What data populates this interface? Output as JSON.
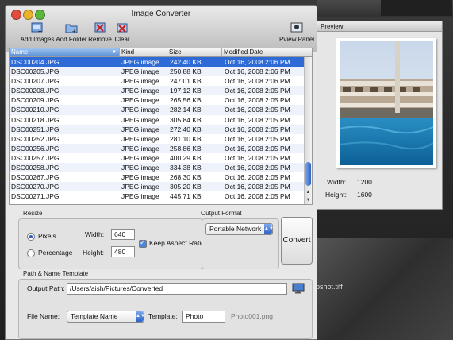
{
  "window": {
    "title": "Image Converter"
  },
  "toolbar": {
    "add_images": "Add Images",
    "add_folder": "Add Folder",
    "remove": "Remove",
    "clear": "Clear",
    "preview_panel": "Pview Panel"
  },
  "table": {
    "columns": [
      "Name",
      "Kind",
      "Size",
      "Modified Date"
    ],
    "rows": [
      {
        "name": "DSC00204.JPG",
        "kind": "JPEG image",
        "size": "242.40 KB",
        "date": "Oct 16, 2008 2:06 PM",
        "selected": true
      },
      {
        "name": "DSC00205.JPG",
        "kind": "JPEG image",
        "size": "250.88 KB",
        "date": "Oct 16, 2008 2:06 PM"
      },
      {
        "name": "DSC00207.JPG",
        "kind": "JPEG image",
        "size": "247.01 KB",
        "date": "Oct 16, 2008 2:06 PM"
      },
      {
        "name": "DSC00208.JPG",
        "kind": "JPEG image",
        "size": "197.12 KB",
        "date": "Oct 16, 2008 2:05 PM"
      },
      {
        "name": "DSC00209.JPG",
        "kind": "JPEG image",
        "size": "265.56 KB",
        "date": "Oct 16, 2008 2:05 PM"
      },
      {
        "name": "DSC00210.JPG",
        "kind": "JPEG image",
        "size": "282.14 KB",
        "date": "Oct 16, 2008 2:05 PM"
      },
      {
        "name": "DSC00218.JPG",
        "kind": "JPEG image",
        "size": "305.84 KB",
        "date": "Oct 16, 2008 2:05 PM"
      },
      {
        "name": "DSC00251.JPG",
        "kind": "JPEG image",
        "size": "272.40 KB",
        "date": "Oct 16, 2008 2:05 PM"
      },
      {
        "name": "DSC00252.JPG",
        "kind": "JPEG image",
        "size": "281.10 KB",
        "date": "Oct 16, 2008 2:05 PM"
      },
      {
        "name": "DSC00256.JPG",
        "kind": "JPEG image",
        "size": "258.86 KB",
        "date": "Oct 16, 2008 2:05 PM"
      },
      {
        "name": "DSC00257.JPG",
        "kind": "JPEG image",
        "size": "400.29 KB",
        "date": "Oct 16, 2008 2:05 PM"
      },
      {
        "name": "DSC00258.JPG",
        "kind": "JPEG image",
        "size": "334.38 KB",
        "date": "Oct 16, 2008 2:05 PM"
      },
      {
        "name": "DSC00267.JPG",
        "kind": "JPEG image",
        "size": "268.30 KB",
        "date": "Oct 16, 2008 2:05 PM"
      },
      {
        "name": "DSC00270.JPG",
        "kind": "JPEG image",
        "size": "305.20 KB",
        "date": "Oct 16, 2008 2:05 PM"
      },
      {
        "name": "DSC00271.JPG",
        "kind": "JPEG image",
        "size": "445.71 KB",
        "date": "Oct 16, 2008 2:05 PM"
      }
    ]
  },
  "resize": {
    "label": "Resize",
    "pixels": "Pixels",
    "percentage": "Percentage",
    "width_label": "Width:",
    "width_value": "640",
    "height_label": "Height:",
    "height_value": "480",
    "keep_aspect": "Keep Aspect Ratio",
    "mode": "pixels",
    "keep_aspect_checked": true
  },
  "output_format": {
    "label": "Output Format",
    "value": "Portable Network"
  },
  "convert_label": "Convert",
  "path": {
    "label": "Path & Name Template",
    "output_path_label": "Output Path:",
    "output_path_value": "/Users/aish/Pictures/Converted",
    "file_name_label": "File Name:",
    "file_name_value": "Template Name",
    "template_label": "Template:",
    "template_value": "Photo",
    "example": "Photo001.png"
  },
  "preview": {
    "title": "Preview",
    "width_label": "Width:",
    "width_value": "1200",
    "height_label": "Height:",
    "height_value": "1600"
  },
  "desktop": {
    "background_file": "pshot.tiff"
  },
  "colors": {
    "selection": "#2e6bd6",
    "accent": "#4d86de",
    "red": "#e24b3e",
    "yellow": "#e8b32b",
    "green": "#5cb83c"
  }
}
